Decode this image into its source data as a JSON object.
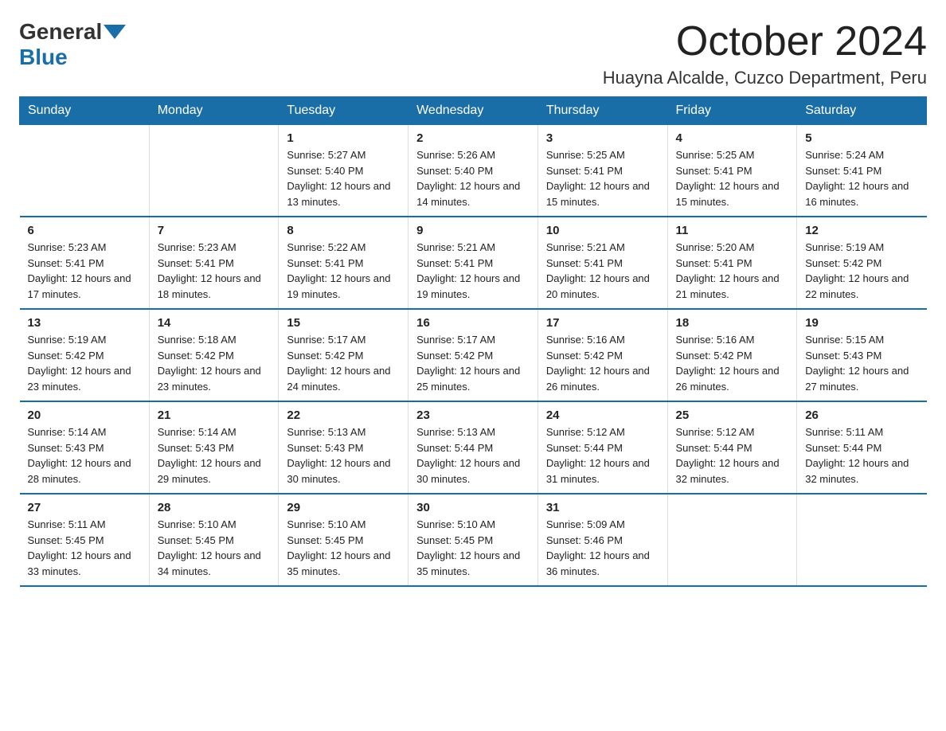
{
  "header": {
    "logo_general": "General",
    "logo_blue": "Blue",
    "main_title": "October 2024",
    "subtitle": "Huayna Alcalde, Cuzco Department, Peru"
  },
  "days_of_week": [
    "Sunday",
    "Monday",
    "Tuesday",
    "Wednesday",
    "Thursday",
    "Friday",
    "Saturday"
  ],
  "weeks": [
    [
      {
        "day": "",
        "info": ""
      },
      {
        "day": "",
        "info": ""
      },
      {
        "day": "1",
        "info": "Sunrise: 5:27 AM\nSunset: 5:40 PM\nDaylight: 12 hours and 13 minutes."
      },
      {
        "day": "2",
        "info": "Sunrise: 5:26 AM\nSunset: 5:40 PM\nDaylight: 12 hours and 14 minutes."
      },
      {
        "day": "3",
        "info": "Sunrise: 5:25 AM\nSunset: 5:41 PM\nDaylight: 12 hours and 15 minutes."
      },
      {
        "day": "4",
        "info": "Sunrise: 5:25 AM\nSunset: 5:41 PM\nDaylight: 12 hours and 15 minutes."
      },
      {
        "day": "5",
        "info": "Sunrise: 5:24 AM\nSunset: 5:41 PM\nDaylight: 12 hours and 16 minutes."
      }
    ],
    [
      {
        "day": "6",
        "info": "Sunrise: 5:23 AM\nSunset: 5:41 PM\nDaylight: 12 hours and 17 minutes."
      },
      {
        "day": "7",
        "info": "Sunrise: 5:23 AM\nSunset: 5:41 PM\nDaylight: 12 hours and 18 minutes."
      },
      {
        "day": "8",
        "info": "Sunrise: 5:22 AM\nSunset: 5:41 PM\nDaylight: 12 hours and 19 minutes."
      },
      {
        "day": "9",
        "info": "Sunrise: 5:21 AM\nSunset: 5:41 PM\nDaylight: 12 hours and 19 minutes."
      },
      {
        "day": "10",
        "info": "Sunrise: 5:21 AM\nSunset: 5:41 PM\nDaylight: 12 hours and 20 minutes."
      },
      {
        "day": "11",
        "info": "Sunrise: 5:20 AM\nSunset: 5:41 PM\nDaylight: 12 hours and 21 minutes."
      },
      {
        "day": "12",
        "info": "Sunrise: 5:19 AM\nSunset: 5:42 PM\nDaylight: 12 hours and 22 minutes."
      }
    ],
    [
      {
        "day": "13",
        "info": "Sunrise: 5:19 AM\nSunset: 5:42 PM\nDaylight: 12 hours and 23 minutes."
      },
      {
        "day": "14",
        "info": "Sunrise: 5:18 AM\nSunset: 5:42 PM\nDaylight: 12 hours and 23 minutes."
      },
      {
        "day": "15",
        "info": "Sunrise: 5:17 AM\nSunset: 5:42 PM\nDaylight: 12 hours and 24 minutes."
      },
      {
        "day": "16",
        "info": "Sunrise: 5:17 AM\nSunset: 5:42 PM\nDaylight: 12 hours and 25 minutes."
      },
      {
        "day": "17",
        "info": "Sunrise: 5:16 AM\nSunset: 5:42 PM\nDaylight: 12 hours and 26 minutes."
      },
      {
        "day": "18",
        "info": "Sunrise: 5:16 AM\nSunset: 5:42 PM\nDaylight: 12 hours and 26 minutes."
      },
      {
        "day": "19",
        "info": "Sunrise: 5:15 AM\nSunset: 5:43 PM\nDaylight: 12 hours and 27 minutes."
      }
    ],
    [
      {
        "day": "20",
        "info": "Sunrise: 5:14 AM\nSunset: 5:43 PM\nDaylight: 12 hours and 28 minutes."
      },
      {
        "day": "21",
        "info": "Sunrise: 5:14 AM\nSunset: 5:43 PM\nDaylight: 12 hours and 29 minutes."
      },
      {
        "day": "22",
        "info": "Sunrise: 5:13 AM\nSunset: 5:43 PM\nDaylight: 12 hours and 30 minutes."
      },
      {
        "day": "23",
        "info": "Sunrise: 5:13 AM\nSunset: 5:44 PM\nDaylight: 12 hours and 30 minutes."
      },
      {
        "day": "24",
        "info": "Sunrise: 5:12 AM\nSunset: 5:44 PM\nDaylight: 12 hours and 31 minutes."
      },
      {
        "day": "25",
        "info": "Sunrise: 5:12 AM\nSunset: 5:44 PM\nDaylight: 12 hours and 32 minutes."
      },
      {
        "day": "26",
        "info": "Sunrise: 5:11 AM\nSunset: 5:44 PM\nDaylight: 12 hours and 32 minutes."
      }
    ],
    [
      {
        "day": "27",
        "info": "Sunrise: 5:11 AM\nSunset: 5:45 PM\nDaylight: 12 hours and 33 minutes."
      },
      {
        "day": "28",
        "info": "Sunrise: 5:10 AM\nSunset: 5:45 PM\nDaylight: 12 hours and 34 minutes."
      },
      {
        "day": "29",
        "info": "Sunrise: 5:10 AM\nSunset: 5:45 PM\nDaylight: 12 hours and 35 minutes."
      },
      {
        "day": "30",
        "info": "Sunrise: 5:10 AM\nSunset: 5:45 PM\nDaylight: 12 hours and 35 minutes."
      },
      {
        "day": "31",
        "info": "Sunrise: 5:09 AM\nSunset: 5:46 PM\nDaylight: 12 hours and 36 minutes."
      },
      {
        "day": "",
        "info": ""
      },
      {
        "day": "",
        "info": ""
      }
    ]
  ]
}
